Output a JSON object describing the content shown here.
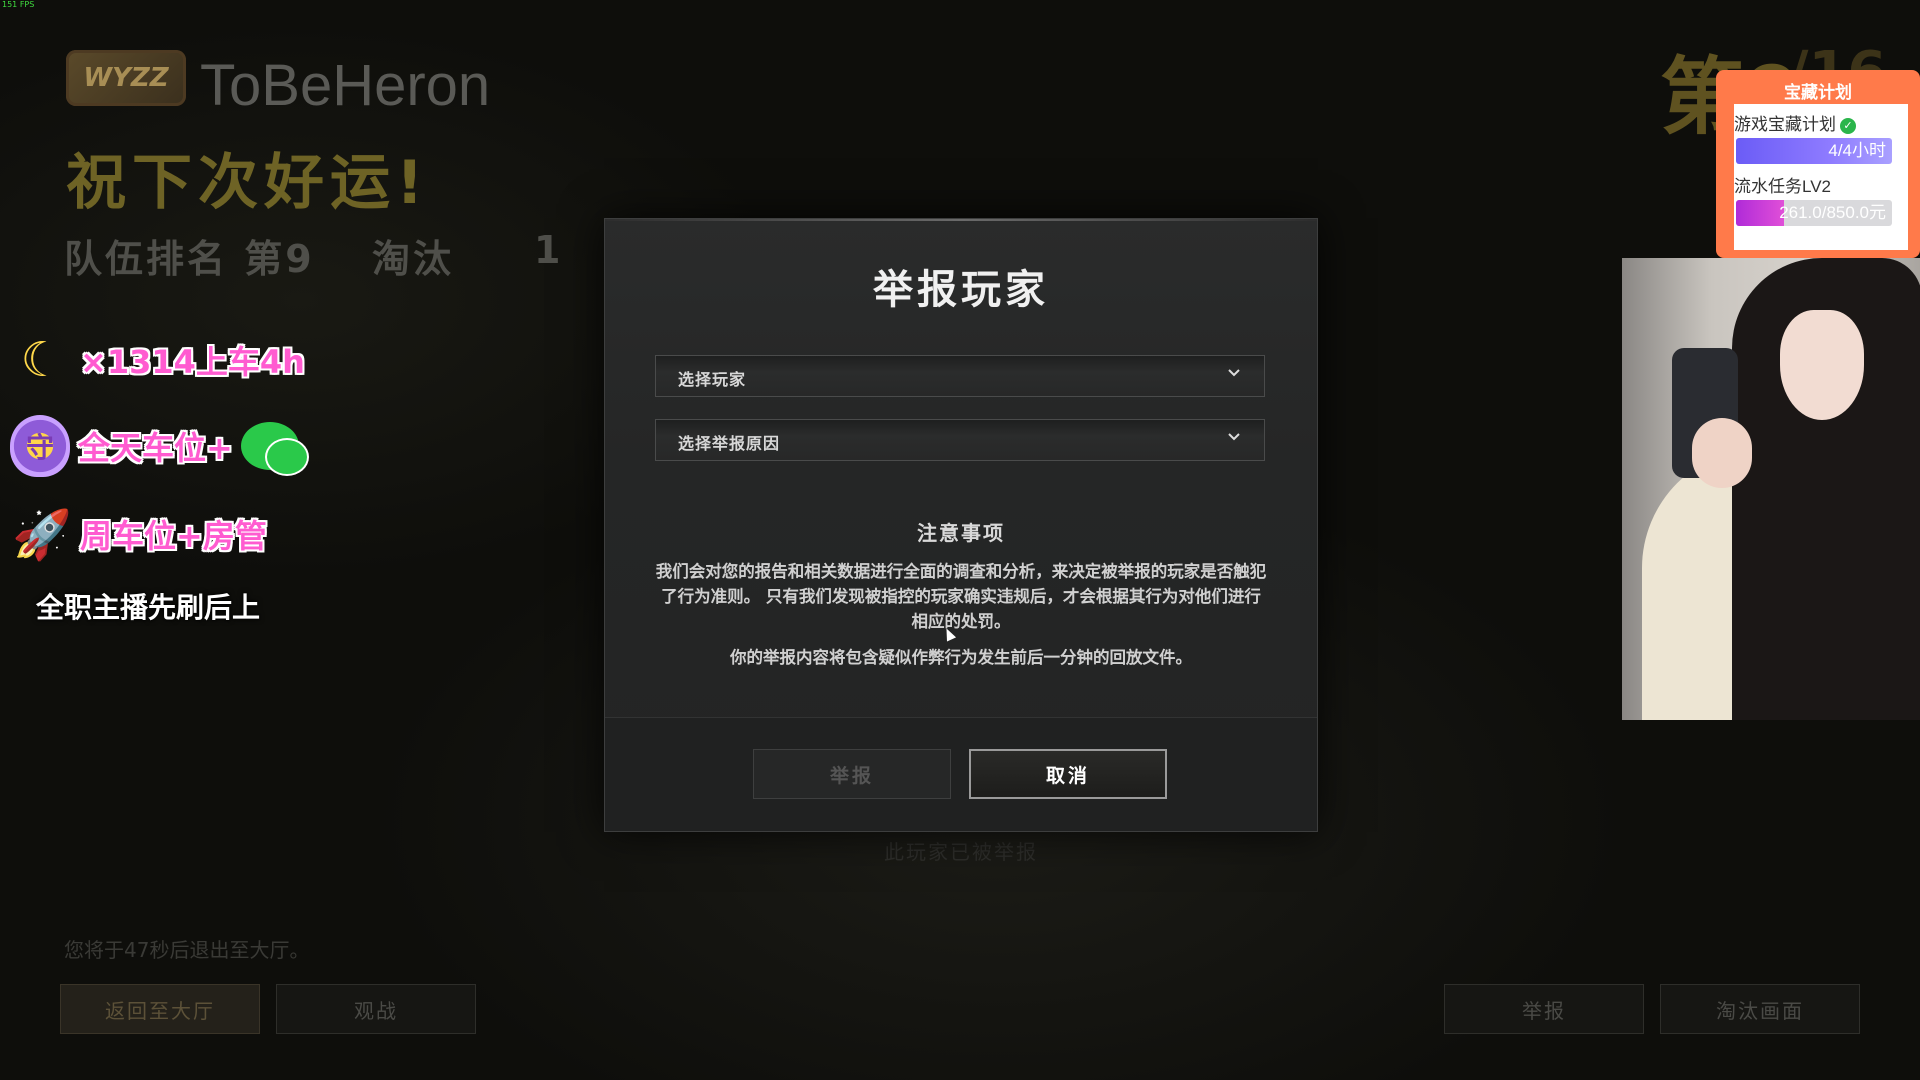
{
  "overlay": {
    "fps": "151 FPS"
  },
  "background": {
    "brand_logo_text": "WYZZ",
    "player_name": "ToBeHeron",
    "result_title": "祝下次好运!",
    "team_rank": "队伍排名  第9",
    "eliminations_label": "淘汰",
    "eliminations_value": "1",
    "big_rank": "第9",
    "big_rank_total": "/16",
    "countdown": "您将于47秒后退出至大厅。",
    "already_reported": "此玩家已被举报",
    "buttons": {
      "return_lobby": "返回至大厅",
      "spectate": "观战",
      "report": "举报",
      "elimination_screen": "淘汰画面"
    }
  },
  "stream_overlay": {
    "promos": [
      {
        "icon": "moon-icon",
        "text": "×1314上车4h"
      },
      {
        "icon": "guardian-shield-icon",
        "text": "全天车位+"
      },
      {
        "icon": "rocket-icon",
        "text": "周车位+房管"
      }
    ],
    "guardian_shield_glyph": "守",
    "note": "全职主播先刷后上",
    "plan": {
      "title": "宝藏计划",
      "row1_label": "游戏宝藏计划",
      "row1_value": "4/4小时",
      "row2_label": "流水任务LV2",
      "row2_value": "261.0/850.0元",
      "row2_progress": 0.307
    }
  },
  "modal": {
    "title": "举报玩家",
    "select_player_placeholder": "选择玩家",
    "select_reason_placeholder": "选择举报原因",
    "notice_title": "注意事项",
    "notice_body": "我们会对您的报告和相关数据进行全面的调查和分析，来决定被举报的玩家是否触犯了行为准则。 只有我们发现被指控的玩家确实违规后，才会根据其行为对他们进行相应的处罚。",
    "notice_body2": "你的举报内容将包含疑似作弊行为发生前后一分钟的回放文件。",
    "report_button": "举报",
    "cancel_button": "取消"
  }
}
